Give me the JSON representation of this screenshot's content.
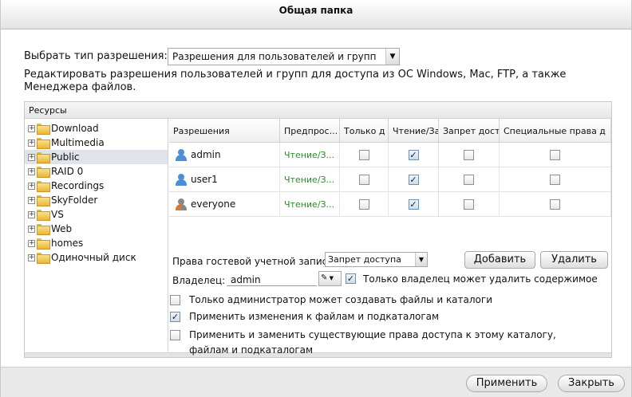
{
  "window": {
    "title": "Общая папка"
  },
  "permission_type": {
    "label": "Выбрать тип разрешения:",
    "selected": "Разрешения для пользователей и групп"
  },
  "description": "Редактировать разрешения пользователей и групп для доступа из ОС Windows, Mac, FTP, а также Менеджера файлов.",
  "resources": {
    "header": "Ресурсы",
    "folders": [
      {
        "label": "Download",
        "selected": false
      },
      {
        "label": "Multimedia",
        "selected": false
      },
      {
        "label": "Public",
        "selected": true
      },
      {
        "label": "RAID 0",
        "selected": false
      },
      {
        "label": "Recordings",
        "selected": false
      },
      {
        "label": "SkyFolder",
        "selected": false
      },
      {
        "label": "VS",
        "selected": false
      },
      {
        "label": "Web",
        "selected": false
      },
      {
        "label": "homes",
        "selected": false
      },
      {
        "label": "Одиночный диск",
        "selected": false
      }
    ]
  },
  "permissions_table": {
    "columns": [
      "Разрешения",
      "Предпрос...",
      "Только д",
      "Чтение/За",
      "Запрет дост",
      "Специальные права д"
    ],
    "rows": [
      {
        "name": "admin",
        "preview": "Чтение/З...",
        "read_only": false,
        "read_write": true,
        "deny": false,
        "special": false
      },
      {
        "name": "user1",
        "preview": "Чтение/З...",
        "read_only": false,
        "read_write": true,
        "deny": false,
        "special": false
      },
      {
        "name": "everyone",
        "preview": "Чтение/З...",
        "read_only": false,
        "read_write": true,
        "deny": false,
        "special": false
      }
    ]
  },
  "guest": {
    "label": "Права гостевой учетной записи:",
    "selected": "Запрет доступа"
  },
  "buttons": {
    "add": "Добавить",
    "remove": "Удалить",
    "apply": "Применить",
    "close": "Закрыть"
  },
  "owner": {
    "label": "Владелец:",
    "value": "admin",
    "only_owner_delete_label": "Только владелец может удалить содержимое",
    "only_owner_delete_checked": true
  },
  "options": [
    {
      "label": "Только администратор может создавать файлы и каталоги",
      "checked": false
    },
    {
      "label": "Применить изменения к файлам и подкаталогам",
      "checked": true
    },
    {
      "label": "Применить и заменить существующие права доступа к этому каталогу, файлам и подкаталогам",
      "checked": false
    }
  ]
}
